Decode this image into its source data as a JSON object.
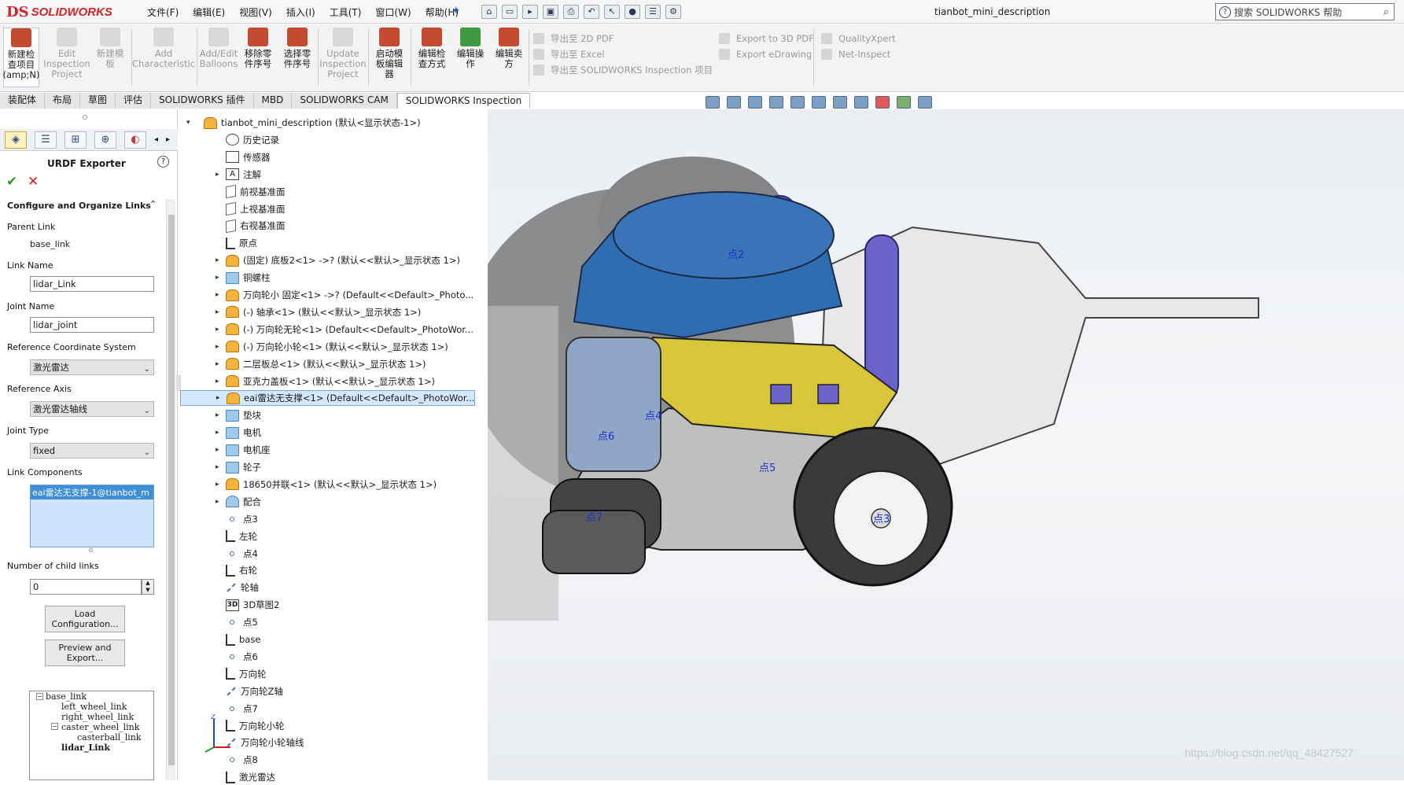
{
  "app": {
    "logo_ds": "DS",
    "logo_text": "SOLIDWORKS",
    "document_title": "tianbot_mini_description",
    "search_placeholder": "搜索 SOLIDWORKS 帮助"
  },
  "menu": [
    "文件(F)",
    "编辑(E)",
    "视图(V)",
    "插入(I)",
    "工具(T)",
    "窗口(W)",
    "帮助(H)"
  ],
  "command_buttons": [
    {
      "label": "新建检查项目(amp;N)",
      "lines": [
        "新建检",
        "查项目",
        "(amp;N)"
      ],
      "enabled": true
    },
    {
      "label": "Edit Inspection Project",
      "lines": [
        "Edit",
        "Inspection",
        "Project"
      ],
      "enabled": false
    },
    {
      "label": "新建模板",
      "lines": [
        "新建模",
        "板"
      ],
      "enabled": false
    },
    {
      "label": "Add Characteristic",
      "lines": [
        "Add",
        "Characteristic"
      ],
      "enabled": false
    },
    {
      "label": "Add/Edit Balloons",
      "lines": [
        "Add/Edit",
        "Balloons"
      ],
      "enabled": false
    },
    {
      "label": "移除零件序号",
      "lines": [
        "移除零",
        "件序号"
      ],
      "enabled": true
    },
    {
      "label": "选择零件序号",
      "lines": [
        "选择零",
        "件序号"
      ],
      "enabled": true
    },
    {
      "label": "Update Inspection Project",
      "lines": [
        "Update",
        "Inspection",
        "Project"
      ],
      "enabled": false
    },
    {
      "label": "启动模板编辑器",
      "lines": [
        "启动模",
        "板编辑",
        "器"
      ],
      "enabled": true
    },
    {
      "label": "编辑检查方式",
      "lines": [
        "编辑检",
        "查方式"
      ],
      "enabled": true
    },
    {
      "label": "编辑操作",
      "lines": [
        "编辑操",
        "作"
      ],
      "enabled": true
    },
    {
      "label": "编辑卖方",
      "lines": [
        "编辑卖",
        "方"
      ],
      "enabled": true
    }
  ],
  "export_group_1": [
    "导出至 2D PDF",
    "导出至 Excel",
    "导出至 SOLIDWORKS Inspection 项目"
  ],
  "export_group_2": [
    "Export to 3D PDF",
    "Export eDrawing"
  ],
  "export_group_3": [
    "QualityXpert",
    "Net-Inspect"
  ],
  "tabs": [
    "装配体",
    "布局",
    "草图",
    "评估",
    "SOLIDWORKS 插件",
    "MBD",
    "SOLIDWORKS CAM",
    "SOLIDWORKS Inspection"
  ],
  "active_tab": "SOLIDWORKS Inspection",
  "urdf": {
    "title": "URDF Exporter",
    "section": "Configure and Organize Links",
    "parent_link_label": "Parent Link",
    "parent_link_value": "base_link",
    "link_name_label": "Link Name",
    "link_name_value": "lidar_Link",
    "joint_name_label": "Joint Name",
    "joint_name_value": "lidar_joint",
    "ref_csys_label": "Reference Coordinate System",
    "ref_csys_value": "激光雷达",
    "ref_axis_label": "Reference Axis",
    "ref_axis_value": "激光雷达轴线",
    "joint_type_label": "Joint Type",
    "joint_type_value": "fixed",
    "link_components_label": "Link Components",
    "link_components_value": "eai雷达无支撑-1@tianbot_m",
    "child_links_label": "Number of child links",
    "child_links_value": "0",
    "load_btn": "Load Configuration...",
    "load_btn_lines": [
      "Load",
      "Configuration..."
    ],
    "preview_btn": "Preview and Export...",
    "preview_btn_lines": [
      "Preview and",
      "Export..."
    ],
    "link_tree": [
      "base_link",
      "left_wheel_link",
      "right_wheel_link",
      "caster_wheel_link",
      "casterball_link",
      "lidar_Link"
    ]
  },
  "feature_tree": [
    {
      "text": "tianbot_mini_description  (默认<显示状态-1>)",
      "icon": "part",
      "root": true
    },
    {
      "text": "历史记录",
      "icon": "hist"
    },
    {
      "text": "传感器",
      "icon": "sensor"
    },
    {
      "text": "注解",
      "icon": "ann",
      "arrow": true
    },
    {
      "text": "前视基准面",
      "icon": "plane"
    },
    {
      "text": "上视基准面",
      "icon": "plane"
    },
    {
      "text": "右视基准面",
      "icon": "plane"
    },
    {
      "text": "原点",
      "icon": "csys"
    },
    {
      "text": "(固定) 底板2<1> ->? (默认<<默认>_显示状态 1>)",
      "icon": "part",
      "arrow": true
    },
    {
      "text": "铜螺柱",
      "icon": "folder",
      "arrow": true
    },
    {
      "text": "万向轮小 固定<1> ->? (Default<<Default>_Photo...",
      "icon": "part",
      "arrow": true
    },
    {
      "text": "(-) 轴承<1> (默认<<默认>_显示状态 1>)",
      "icon": "part",
      "arrow": true
    },
    {
      "text": "(-) 万向轮无轮<1> (Default<<Default>_PhotoWor...",
      "icon": "part",
      "arrow": true
    },
    {
      "text": "(-) 万向轮小轮<1> (默认<<默认>_显示状态 1>)",
      "icon": "part",
      "arrow": true
    },
    {
      "text": "二层板总<1> (默认<<默认>_显示状态 1>)",
      "icon": "part",
      "arrow": true
    },
    {
      "text": "亚克力盖板<1> (默认<<默认>_显示状态 1>)",
      "icon": "part",
      "arrow": true
    },
    {
      "text": "eai雷达无支撑<1> (Default<<Default>_PhotoWor...",
      "icon": "part",
      "arrow": true,
      "highlight": true
    },
    {
      "text": "垫块",
      "icon": "folder",
      "arrow": true
    },
    {
      "text": "电机",
      "icon": "folder",
      "arrow": true
    },
    {
      "text": "电机座",
      "icon": "folder",
      "arrow": true
    },
    {
      "text": "轮子",
      "icon": "folder",
      "arrow": true
    },
    {
      "text": "18650并联<1> (默认<<默认>_显示状态 1>)",
      "icon": "part",
      "arrow": true
    },
    {
      "text": "配合",
      "icon": "mate",
      "arrow": true
    },
    {
      "text": "点3",
      "icon": "point"
    },
    {
      "text": "左轮",
      "icon": "csys"
    },
    {
      "text": "点4",
      "icon": "point"
    },
    {
      "text": "右轮",
      "icon": "csys"
    },
    {
      "text": "轮轴",
      "icon": "axis"
    },
    {
      "text": "3D草图2",
      "icon": "s3d"
    },
    {
      "text": "点5",
      "icon": "point"
    },
    {
      "text": "base",
      "icon": "csys"
    },
    {
      "text": "点6",
      "icon": "point"
    },
    {
      "text": "万向轮",
      "icon": "csys"
    },
    {
      "text": "万向轮Z轴",
      "icon": "axis"
    },
    {
      "text": "点7",
      "icon": "point"
    },
    {
      "text": "万向轮小轮",
      "icon": "csys"
    },
    {
      "text": "万向轮小轮轴线",
      "icon": "axis"
    },
    {
      "text": "点8",
      "icon": "point"
    },
    {
      "text": "激光雷达",
      "icon": "csys"
    }
  ],
  "model_labels": [
    "点2",
    "点4",
    "点6",
    "点5",
    "点7",
    "点3"
  ],
  "triad": {
    "x": "X",
    "y": "Y",
    "z": "Z"
  },
  "watermark": "https://blog.csdn.net/qq_48427527",
  "colors": {
    "brand_red": "#d2232a",
    "lidar_blue": "#3a74b8",
    "board_yellow": "#d8c63a",
    "post_purple": "#6b63c8",
    "highlight": "#d4e8fb"
  }
}
